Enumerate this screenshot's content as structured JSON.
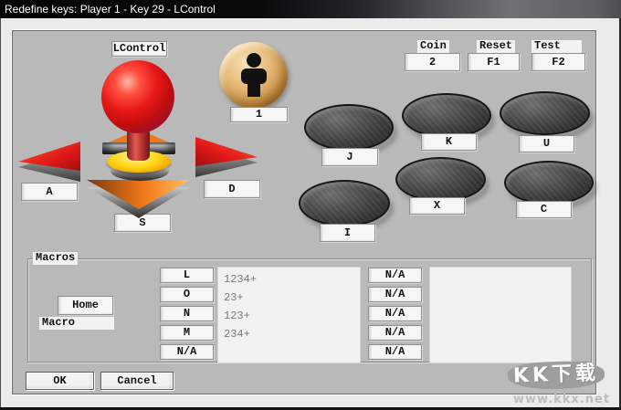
{
  "window": {
    "title": "Redefine keys: Player 1 - Key 29 - LControl"
  },
  "joystick": {
    "assigned_key": "LControl",
    "left_key": "A",
    "right_key": "D",
    "down_key": "S"
  },
  "player": {
    "number": "1"
  },
  "system": {
    "coin_label": "Coin",
    "coin_value": "2",
    "reset_label": "Reset",
    "reset_value": "F1",
    "test_label": "Test",
    "test_value": "F2"
  },
  "action_keys": [
    "J",
    "K",
    "U",
    "I",
    "X",
    "C"
  ],
  "macros": {
    "label": "Macros",
    "home": "Home",
    "caption": "Macro",
    "left_slots": [
      "L",
      "O",
      "N",
      "M",
      "N/A"
    ],
    "left_lines": [
      "1234+",
      "23+",
      "123+",
      "234+"
    ],
    "right_slots": [
      "N/A",
      "N/A",
      "N/A",
      "N/A",
      "N/A"
    ]
  },
  "footer": {
    "ok": "OK",
    "cancel": "Cancel"
  },
  "watermark": {
    "logo": "KK下载",
    "site": "www.kkx.net"
  },
  "colors": {
    "client-bg": "#b9b9b9",
    "button-face": "#f6f6f6",
    "joystick-red": "#dd1515",
    "arrow-orange": "#f07818",
    "player-gold": "#d9a95f"
  }
}
